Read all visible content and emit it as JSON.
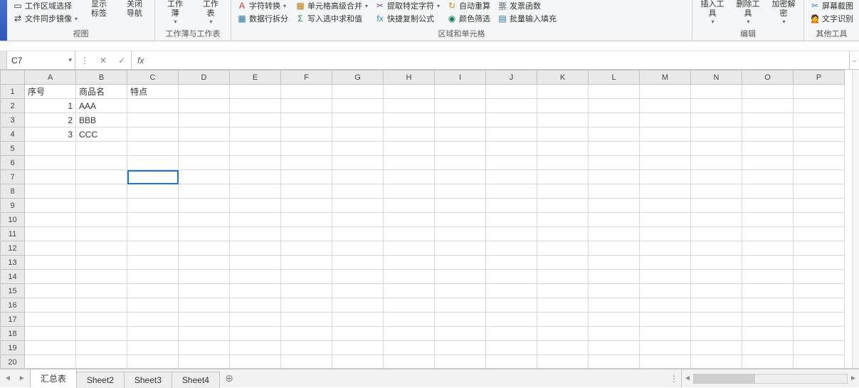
{
  "ribbon": {
    "group_view": {
      "label": "视图",
      "work_area_select": "工作区域选择",
      "file_sync_mirror": "文件同步镜像",
      "show_label": "显示\n标签",
      "close_nav": "关闭\n导航"
    },
    "group_workbook": {
      "label": "工作薄与工作表",
      "workbook": "工作\n薄",
      "worksheet": "工作\n表"
    },
    "group_region": {
      "label": "区域和单元格",
      "char_convert": "字符转换",
      "cell_advanced_merge": "单元格高级合并",
      "extract_selected_chars": "提取特定字符",
      "auto_recalc": "自动重算",
      "invoice_func": "发票函数",
      "data_row_split": "数据行拆分",
      "write_selected_sum": "写入选中求和值",
      "quick_copy_formula": "快捷复制公式",
      "color_filter": "颜色筛选",
      "batch_input_fill": "批量输入填充"
    },
    "group_edit": {
      "label": "编辑",
      "insert_tool": "插入工\n具",
      "delete_tool": "删除工\n具",
      "encrypt_decrypt": "加密解\n密"
    },
    "group_other": {
      "label": "其他工具",
      "screen_capture": "屏幕截图",
      "ocr": "文字识别"
    }
  },
  "formula_bar": {
    "name_box": "C7",
    "fx_label": "fx",
    "formula": ""
  },
  "grid": {
    "columns": [
      "A",
      "B",
      "C",
      "D",
      "E",
      "F",
      "G",
      "H",
      "I",
      "J",
      "K",
      "L",
      "M",
      "N",
      "O",
      "P"
    ],
    "row_count": 21,
    "cells": {
      "A1": "序号",
      "B1": "商品名",
      "C1": "特点",
      "A2": "1",
      "B2": "AAA",
      "A3": "2",
      "B3": "BBB",
      "A4": "3",
      "B4": "CCC"
    },
    "numeric_cols": [
      "A"
    ],
    "active_cell": "C7"
  },
  "sheet_tabs": {
    "tabs": [
      "汇总表",
      "Sheet2",
      "Sheet3",
      "Sheet4"
    ],
    "active": "汇总表"
  }
}
